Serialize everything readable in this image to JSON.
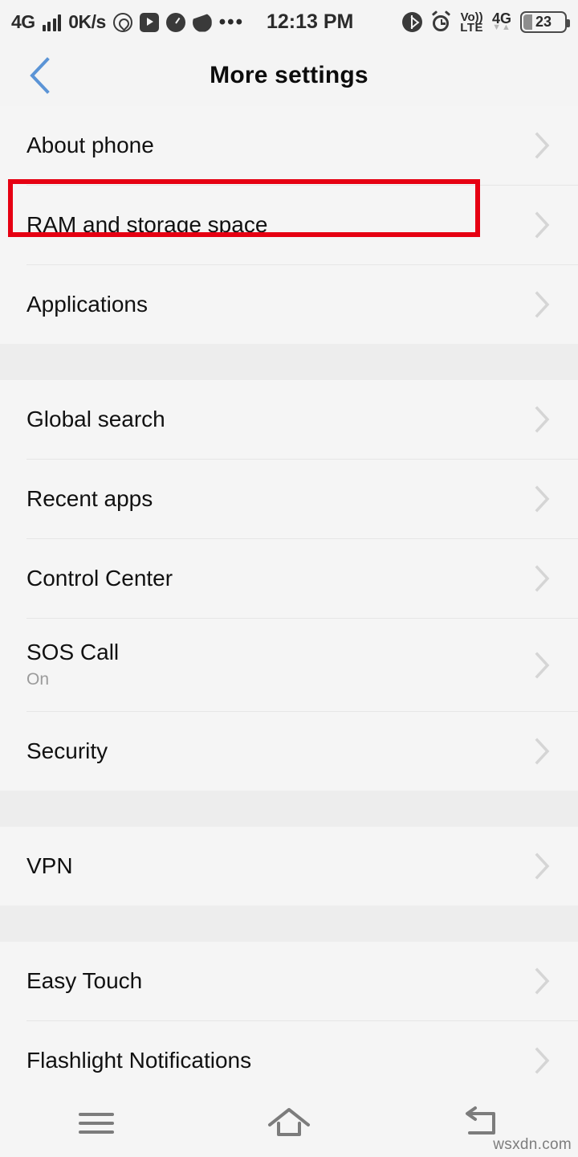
{
  "statusbar": {
    "network_type": "4G",
    "data_speed": "0K/s",
    "app_icons": [
      "whatsapp-icon",
      "youtube-icon",
      "app-icon-3",
      "app-icon-4"
    ],
    "overflow": "•••",
    "time": "12:13 PM",
    "right_icons": [
      "bluetooth-icon",
      "alarm-icon"
    ],
    "volte_line1": "Vo))",
    "volte_line2": "LTE",
    "secondary_network": "4G",
    "data_arrows": "▼▲",
    "battery_percent": "23"
  },
  "header": {
    "back_label": "Back",
    "title": "More settings"
  },
  "colors": {
    "accent_blue": "#5b94d6",
    "highlight_red": "#e60012",
    "row_bg": "#f5f5f5",
    "spacer_bg": "#ededed",
    "chevron": "#d5d5d5",
    "subtitle": "#9b9b9b"
  },
  "sections": [
    {
      "id": "section-system",
      "rows": [
        {
          "id": "about-phone",
          "title": "About phone",
          "sub": null,
          "highlighted": false
        },
        {
          "id": "ram-and-storage-space",
          "title": "RAM and storage space",
          "sub": null,
          "highlighted": true
        },
        {
          "id": "applications",
          "title": "Applications",
          "sub": null,
          "highlighted": false
        }
      ]
    },
    {
      "id": "section-features",
      "rows": [
        {
          "id": "global-search",
          "title": "Global search",
          "sub": null,
          "highlighted": false
        },
        {
          "id": "recent-apps",
          "title": "Recent apps",
          "sub": null,
          "highlighted": false
        },
        {
          "id": "control-center",
          "title": "Control Center",
          "sub": null,
          "highlighted": false
        },
        {
          "id": "sos-call",
          "title": "SOS Call",
          "sub": "On",
          "highlighted": false
        },
        {
          "id": "security",
          "title": "Security",
          "sub": null,
          "highlighted": false
        }
      ]
    },
    {
      "id": "section-network",
      "rows": [
        {
          "id": "vpn",
          "title": "VPN",
          "sub": null,
          "highlighted": false
        }
      ]
    },
    {
      "id": "section-tools",
      "rows": [
        {
          "id": "easy-touch",
          "title": "Easy Touch",
          "sub": null,
          "highlighted": false
        },
        {
          "id": "flashlight-notifications",
          "title": "Flashlight Notifications",
          "sub": null,
          "highlighted": false
        }
      ]
    }
  ],
  "navbar": {
    "menu_label": "Menu",
    "home_label": "Home",
    "back_label": "Back"
  },
  "watermark": "wsxdn.com"
}
